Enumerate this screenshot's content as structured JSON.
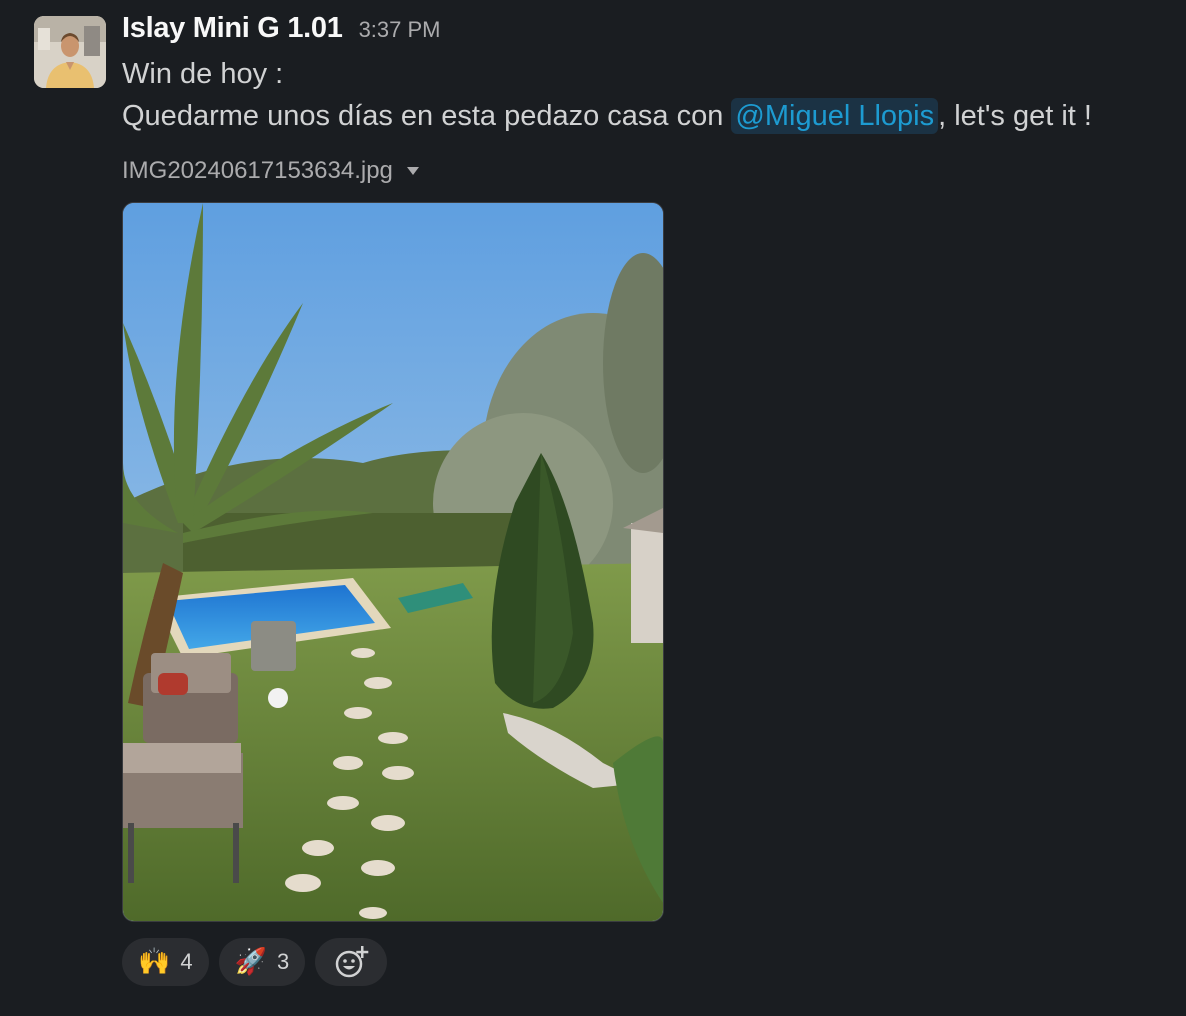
{
  "message": {
    "author": "Islay Mini G 1.01",
    "time": "3:37 PM",
    "line1": "Win de hoy :",
    "line2_before": "Quedarme unos días en esta pedazo casa con ",
    "mention": "@Miguel Llopis",
    "line2_after": ", let's get it !"
  },
  "attachment": {
    "filename": "IMG20240617153634.jpg",
    "image_alt": "Garden with pool, palm tree and cypress"
  },
  "reactions": [
    {
      "emoji": "🙌",
      "count": "4"
    },
    {
      "emoji": "🚀",
      "count": "3"
    }
  ],
  "colors": {
    "background": "#1a1d21",
    "mention": "#1d9bd1",
    "reaction_bg": "#2b2d31"
  }
}
